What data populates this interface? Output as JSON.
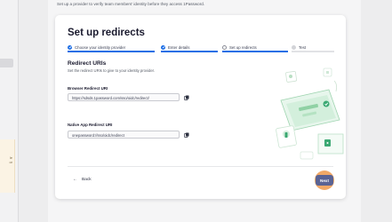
{
  "background_header": {
    "text": "Set up a provider to verify team members' identity before they access 1Password."
  },
  "left_note": {
    "text_lines": [
      "le",
      "or"
    ]
  },
  "modal": {
    "title": "Set up redirects",
    "steps": [
      {
        "label": "Choose your identity provider",
        "state": "complete"
      },
      {
        "label": "Enter details",
        "state": "complete"
      },
      {
        "label": "Set up redirects",
        "state": "current"
      },
      {
        "label": "Test",
        "state": "upcoming"
      }
    ],
    "section": {
      "title": "Redirect URIs",
      "description": "Set the redirect URIs to give to your identity provider."
    },
    "fields": [
      {
        "label": "Browser Redirect URI",
        "value": "https://sdsds.1password.com/sso/oidc/redirect/"
      },
      {
        "label": "Native App Redirect URI",
        "value": "onepassword://sso/oidc/redirect"
      }
    ],
    "footer": {
      "back_label": "Back",
      "next_label": "Next"
    }
  },
  "colors": {
    "accent": "#1f6fe5",
    "next_button": "#5a6394",
    "highlight_ring": "#f0a35e",
    "illustration_green": "#3aa872"
  },
  "icons": {
    "step_complete": "check-circle-icon",
    "step_current": "empty-circle-icon",
    "step_upcoming": "grey-circle-icon",
    "copy": "copy-icon",
    "back": "arrow-left-icon"
  }
}
